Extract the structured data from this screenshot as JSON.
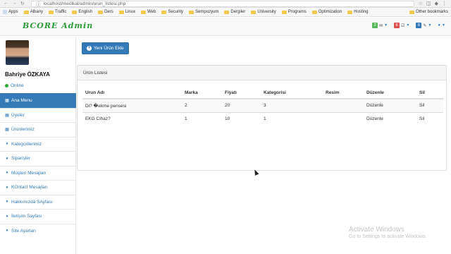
{
  "browser": {
    "url": "localhost/medikal/admin/urun_listesi.php",
    "bookmarks": [
      "Apps",
      "Albany",
      "Traffic",
      "English",
      "Ders",
      "Linux",
      "Web",
      "Security",
      "Sempozyum",
      "Dergiler",
      "University",
      "Programs",
      "Optimization",
      "Hosting"
    ],
    "other_bookmarks": "Other bookmarks"
  },
  "header": {
    "brand": "BCORE Admin",
    "messages_count": "2",
    "tasks_count": "6",
    "alerts_count": "6"
  },
  "sidebar": {
    "username": "Bahriye ÖZKAYA",
    "status": "Online",
    "items": [
      {
        "label": "Ana Menu",
        "icon": "table-icon"
      },
      {
        "label": "Üyeler",
        "icon": "table-icon"
      },
      {
        "label": "Ürünlerimiz",
        "icon": "table-icon"
      },
      {
        "label": "Kategorilerimiz",
        "icon": "map-marker-icon"
      },
      {
        "label": "Siparişler",
        "icon": "map-marker-icon"
      },
      {
        "label": "Müşteri Mesajları",
        "icon": "map-marker-icon"
      },
      {
        "label": "KOntact Mesajları",
        "icon": "map-marker-icon"
      },
      {
        "label": "Hakkımızdâ SAyfası",
        "icon": "map-marker-icon"
      },
      {
        "label": "İletişim Sayfası",
        "icon": "map-marker-icon"
      },
      {
        "label": "Site Ayarları",
        "icon": "map-marker-icon"
      }
    ]
  },
  "main": {
    "add_button": "Yeni Ürün Ekle",
    "panel_title": "Ürün Listesi",
    "columns": [
      "Urun Adı",
      "Marka",
      "Fiyatı",
      "Kategorisi",
      "Resim",
      "Düzenle",
      "Sil"
    ],
    "rows": [
      [
        "Di? �ekme pensesi",
        "2",
        "20",
        "3",
        "",
        "Düzenle",
        "Sil"
      ],
      [
        "EKG Cihaz?",
        "1",
        "10",
        "1",
        "",
        "Düzenle",
        "Sil"
      ]
    ]
  },
  "watermark": {
    "line1": "Activate Windows",
    "line2": "Go to Settings to activate Windows."
  }
}
